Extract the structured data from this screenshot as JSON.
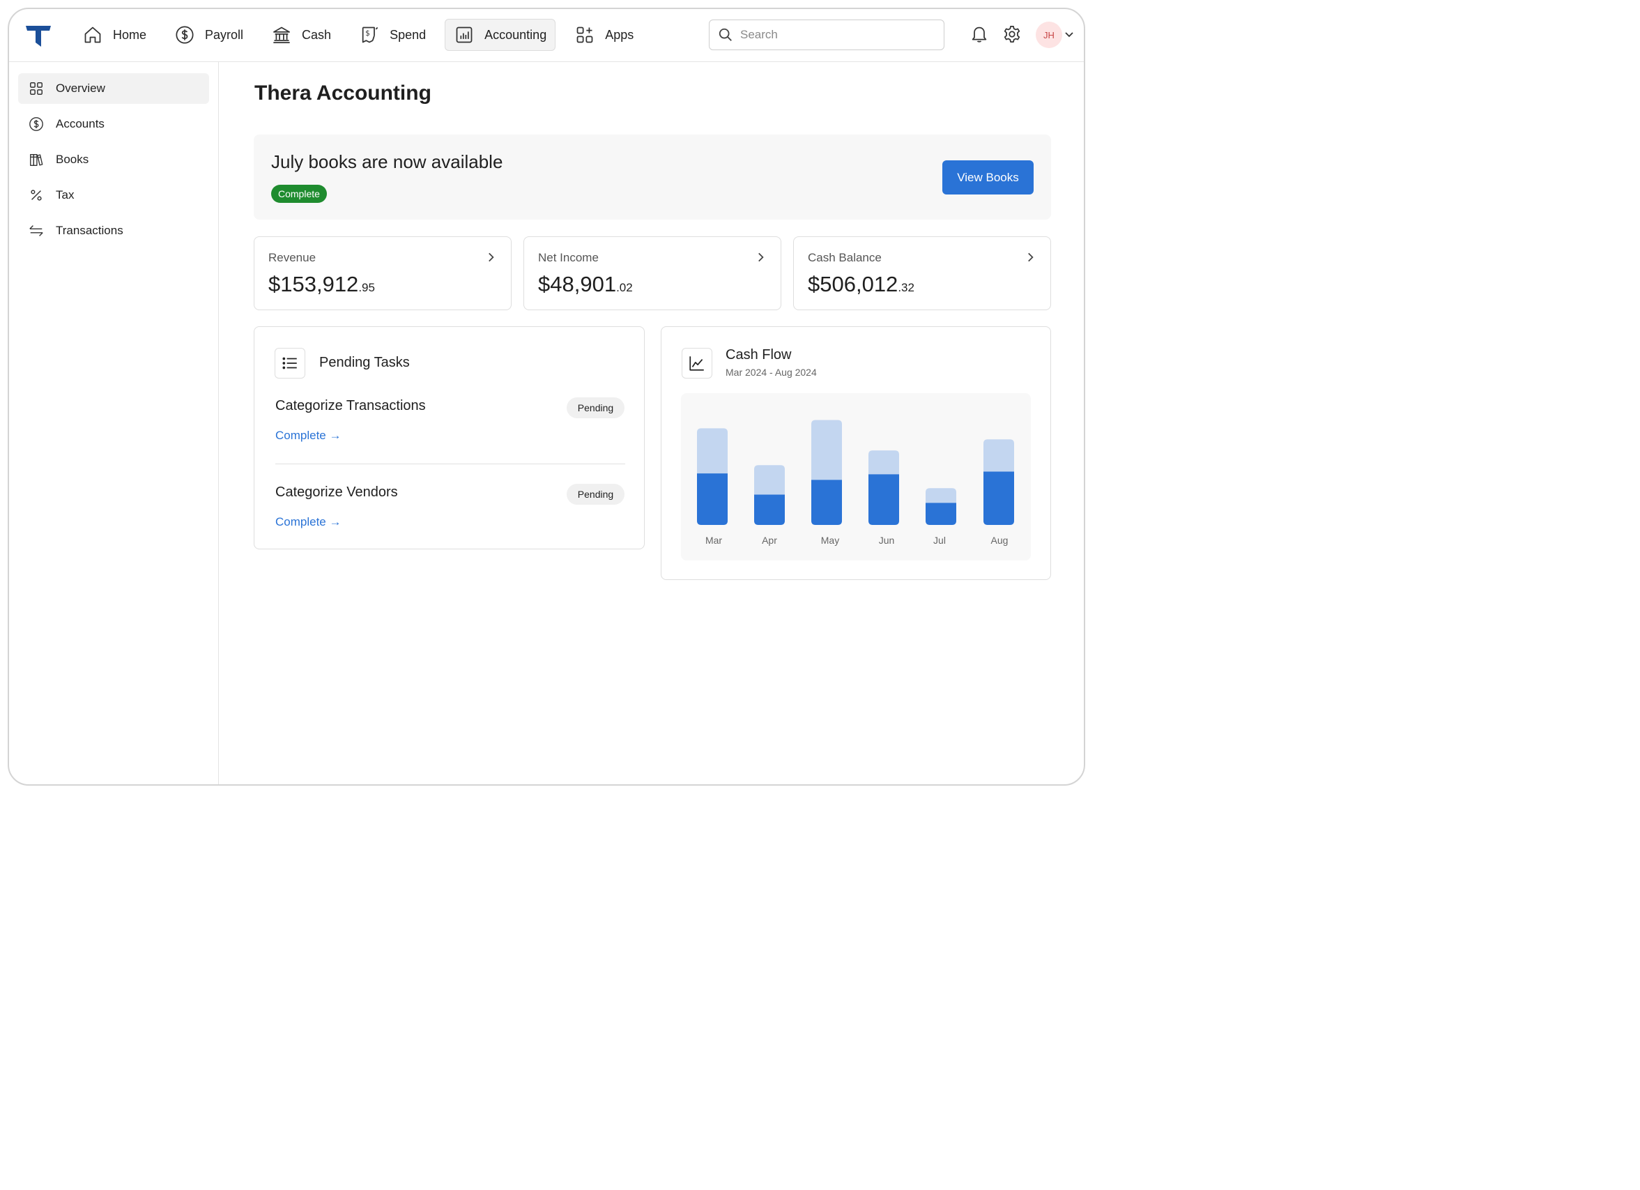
{
  "nav": {
    "items": [
      {
        "label": "Home",
        "icon": "home-icon"
      },
      {
        "label": "Payroll",
        "icon": "dollar-circle-icon"
      },
      {
        "label": "Cash",
        "icon": "bank-icon"
      },
      {
        "label": "Spend",
        "icon": "receipt-icon"
      },
      {
        "label": "Accounting",
        "icon": "bar-chart-icon",
        "active": true
      },
      {
        "label": "Apps",
        "icon": "apps-grid-icon"
      }
    ],
    "search_placeholder": "Search",
    "avatar_initials": "JH"
  },
  "sidebar": {
    "items": [
      {
        "label": "Overview",
        "icon": "grid-icon",
        "active": true
      },
      {
        "label": "Accounts",
        "icon": "dollar-circle-icon"
      },
      {
        "label": "Books",
        "icon": "books-icon"
      },
      {
        "label": "Tax",
        "icon": "percent-icon"
      },
      {
        "label": "Transactions",
        "icon": "transfer-arrows-icon"
      }
    ]
  },
  "page": {
    "title": "Thera Accounting"
  },
  "banner": {
    "title": "July books are now available",
    "status": "Complete",
    "button": "View Books"
  },
  "stats": [
    {
      "label": "Revenue",
      "dollars": "$153,912",
      "cents": ".95"
    },
    {
      "label": "Net Income",
      "dollars": "$48,901",
      "cents": ".02"
    },
    {
      "label": "Cash Balance",
      "dollars": "$506,012",
      "cents": ".32"
    }
  ],
  "tasks": {
    "title": "Pending Tasks",
    "items": [
      {
        "name": "Categorize Transactions",
        "status": "Pending",
        "action": "Complete →"
      },
      {
        "name": "Categorize Vendors",
        "status": "Pending",
        "action": "Complete →"
      }
    ]
  },
  "cashflow": {
    "title": "Cash Flow",
    "subtitle": "Mar 2024 - Aug 2024"
  },
  "chart_data": {
    "type": "bar",
    "stacked": true,
    "categories": [
      "Mar",
      "Apr",
      "May",
      "Jun",
      "Jul",
      "Aug"
    ],
    "series": [
      {
        "color": "#2a73d6",
        "values": [
          56,
          33,
          49,
          55,
          24,
          58
        ]
      },
      {
        "color": "#c3d6f0",
        "values": [
          49,
          32,
          65,
          26,
          16,
          35
        ]
      }
    ],
    "ylim": [
      0,
      120
    ],
    "grid": false,
    "legend": "none"
  },
  "colors": {
    "accent": "#2a73d6",
    "success": "#1f8c2f",
    "brand": "#1b4f99"
  }
}
